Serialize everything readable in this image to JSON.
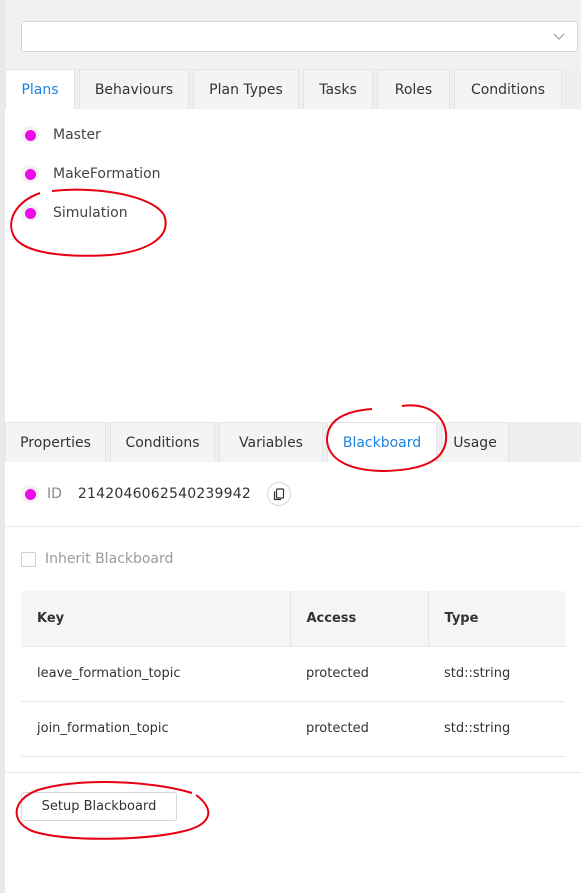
{
  "selector": {
    "value": ""
  },
  "plan_tabs": [
    "Plans",
    "Behaviours",
    "Plan Types",
    "Tasks",
    "Roles",
    "Conditions"
  ],
  "plans": [
    "Master",
    "MakeFormation",
    "Simulation"
  ],
  "detail_tabs": [
    "Properties",
    "Conditions",
    "Variables",
    "Blackboard",
    "Usage"
  ],
  "details": {
    "id_label": "ID",
    "id_value": "2142046062540239942",
    "inherit_label": "Inherit Blackboard",
    "inherit_checked": false,
    "table": {
      "headers": [
        "Key",
        "Access",
        "Type"
      ],
      "rows": [
        [
          "leave_formation_topic",
          "protected",
          "std::string"
        ],
        [
          "join_formation_topic",
          "protected",
          "std::string"
        ]
      ]
    },
    "setup_button": "Setup Blackboard"
  },
  "colors": {
    "accent": "#1a82e2",
    "dot": "#ee0aea",
    "annotation": "#e60012"
  }
}
